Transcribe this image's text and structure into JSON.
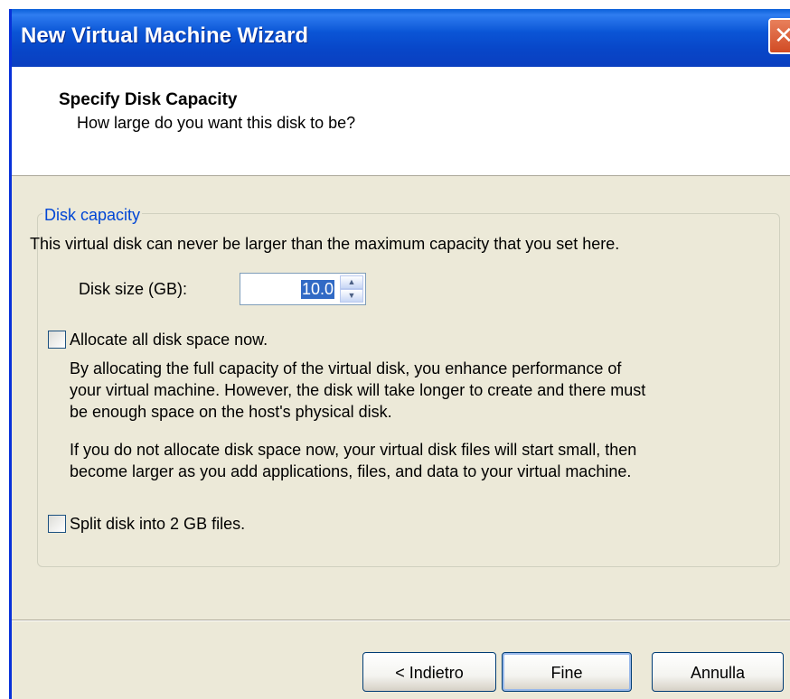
{
  "window": {
    "title": "New Virtual Machine Wizard",
    "close_label": "✕"
  },
  "header": {
    "title": "Specify Disk Capacity",
    "subtitle": "How large do you want this disk to be?"
  },
  "disk_capacity": {
    "group_label": "Disk capacity",
    "description": "This virtual disk can never be larger than the maximum capacity that you set here.",
    "disk_size_label": "Disk size (GB):",
    "disk_size_value": "10.0"
  },
  "allocate": {
    "label": "Allocate all disk space now.",
    "checked": false,
    "desc1_line1": "By allocating the full capacity of the virtual disk, you enhance performance of",
    "desc1_line2": "your virtual machine.  However, the disk will take longer to create and there must",
    "desc1_line3": "be enough space on the host's physical disk.",
    "desc2_line1": "If you do not allocate disk space now, your virtual disk files will start small, then",
    "desc2_line2": "become larger as you add applications, files, and data to your virtual machine."
  },
  "split": {
    "label": "Split disk into 2 GB files.",
    "checked": false
  },
  "buttons": {
    "back": "< Indietro",
    "finish": "Fine",
    "cancel": "Annulla"
  },
  "colors": {
    "titlebar": "#0a55d6",
    "dialog_bg": "#ece9d8",
    "group_label": "#0046d5",
    "selection": "#316ac5"
  }
}
